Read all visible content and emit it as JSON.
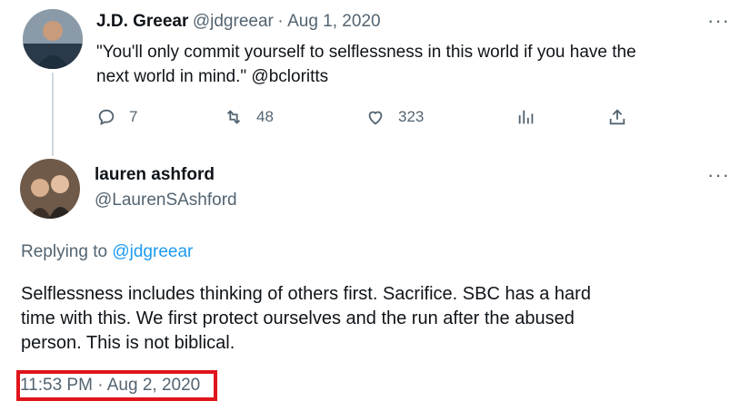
{
  "tweet1": {
    "author_name": "J.D. Greear",
    "handle": "@jdgreear",
    "separator": "·",
    "date": "Aug 1, 2020",
    "text_line1": "\"You'll only commit yourself to selflessness in this world if you have the",
    "text_line2": "next world in mind.\" @bcloritts",
    "replies": "7",
    "retweets": "48",
    "likes": "323"
  },
  "tweet2": {
    "author_name": "lauren ashford",
    "handle": "@LaurenSAshford",
    "replying_prefix": "Replying to",
    "replying_handle": "@jdgreear",
    "text_line1": "Selflessness includes thinking of others first. Sacrifice. SBC has a hard",
    "text_line2": "time with this. We first protect ourselves and the run after the abused",
    "text_line3": "person. This is not biblical.",
    "timestamp": "11:53 PM · Aug 2, 2020"
  },
  "more_glyph": "···",
  "colors": {
    "link": "#1d9bf0",
    "secondary": "#536471",
    "highlight_box": "#e0141b"
  },
  "icons": [
    "reply-icon",
    "retweet-icon",
    "like-icon",
    "views-icon",
    "share-icon",
    "more-icon"
  ]
}
